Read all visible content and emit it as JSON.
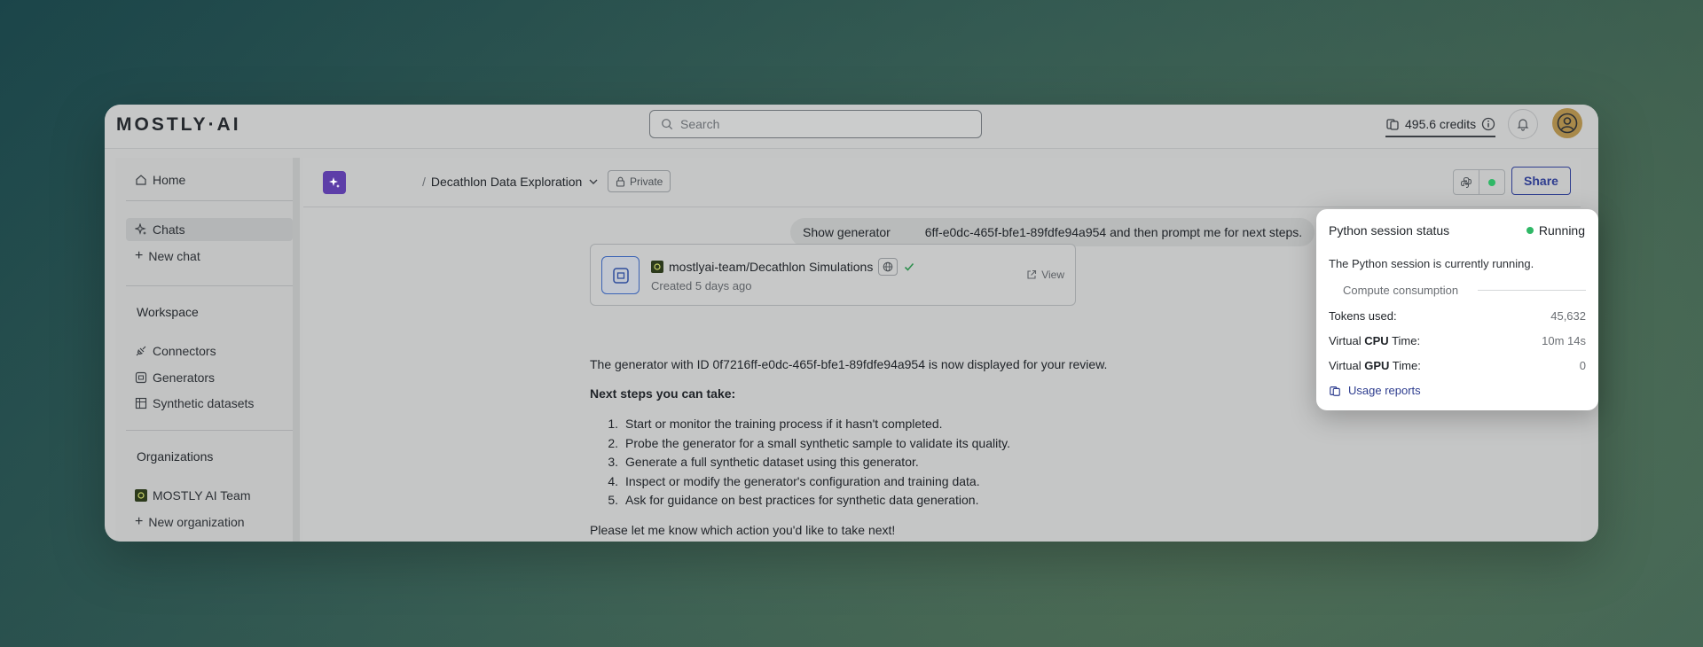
{
  "topbar": {
    "logo": "MOSTLY·AI",
    "search_placeholder": "Search",
    "credits": "495.6 credits"
  },
  "sidebar": {
    "home": "Home",
    "chats": "Chats",
    "new_chat": "New chat",
    "workspace_heading": "Workspace",
    "connectors": "Connectors",
    "generators": "Generators",
    "synthetic_datasets": "Synthetic datasets",
    "organizations_heading": "Organizations",
    "org_name": "MOSTLY AI Team",
    "new_org": "New organization"
  },
  "header": {
    "breadcrumb_sep": "/",
    "chat_title": "Decathlon Data Exploration",
    "privacy": "Private",
    "share": "Share"
  },
  "chat": {
    "user_message": "Show generator          6ff-e0dc-465f-bfe1-89fdfe94a954 and then prompt me for next steps.",
    "generator_card": {
      "name": "mostlyai-team/Decathlon Simulations",
      "created": "Created 5 days ago",
      "view": "View"
    },
    "reply_intro": "The generator with ID 0f7216ff-e0dc-465f-bfe1-89fdfe94a954 is now displayed for your review.",
    "next_steps_heading": "Next steps you can take:",
    "steps": [
      {
        "num": "1.",
        "text": "Start or monitor the training process if it hasn't completed."
      },
      {
        "num": "2.",
        "text": "Probe the generator for a small synthetic sample to validate its quality."
      },
      {
        "num": "3.",
        "text": "Generate a full synthetic dataset using this generator."
      },
      {
        "num": "4.",
        "text": "Inspect or modify the generator's configuration and training data."
      },
      {
        "num": "5.",
        "text": "Ask for guidance on best practices for synthetic data generation."
      }
    ],
    "closing": "Please let me know which action you'd like to take next!"
  },
  "popover": {
    "title": "Python session status",
    "status": "Running",
    "status_color": "#2fb866",
    "description": "The Python session is currently running.",
    "section": "Compute consumption",
    "tokens_label": "Tokens used:",
    "tokens_value": "45,632",
    "cpu_label_pre": "Virtual ",
    "cpu_label_bold": "CPU",
    "cpu_label_post": " Time:",
    "cpu_value": "10m 14s",
    "gpu_label_pre": "Virtual ",
    "gpu_label_bold": "GPU",
    "gpu_label_post": " Time:",
    "gpu_value": "0",
    "usage_link": "Usage reports"
  },
  "colors": {
    "accent": "#2e3d8f",
    "spark_button": "#5d3ea8",
    "status_green": "#2fb866"
  }
}
